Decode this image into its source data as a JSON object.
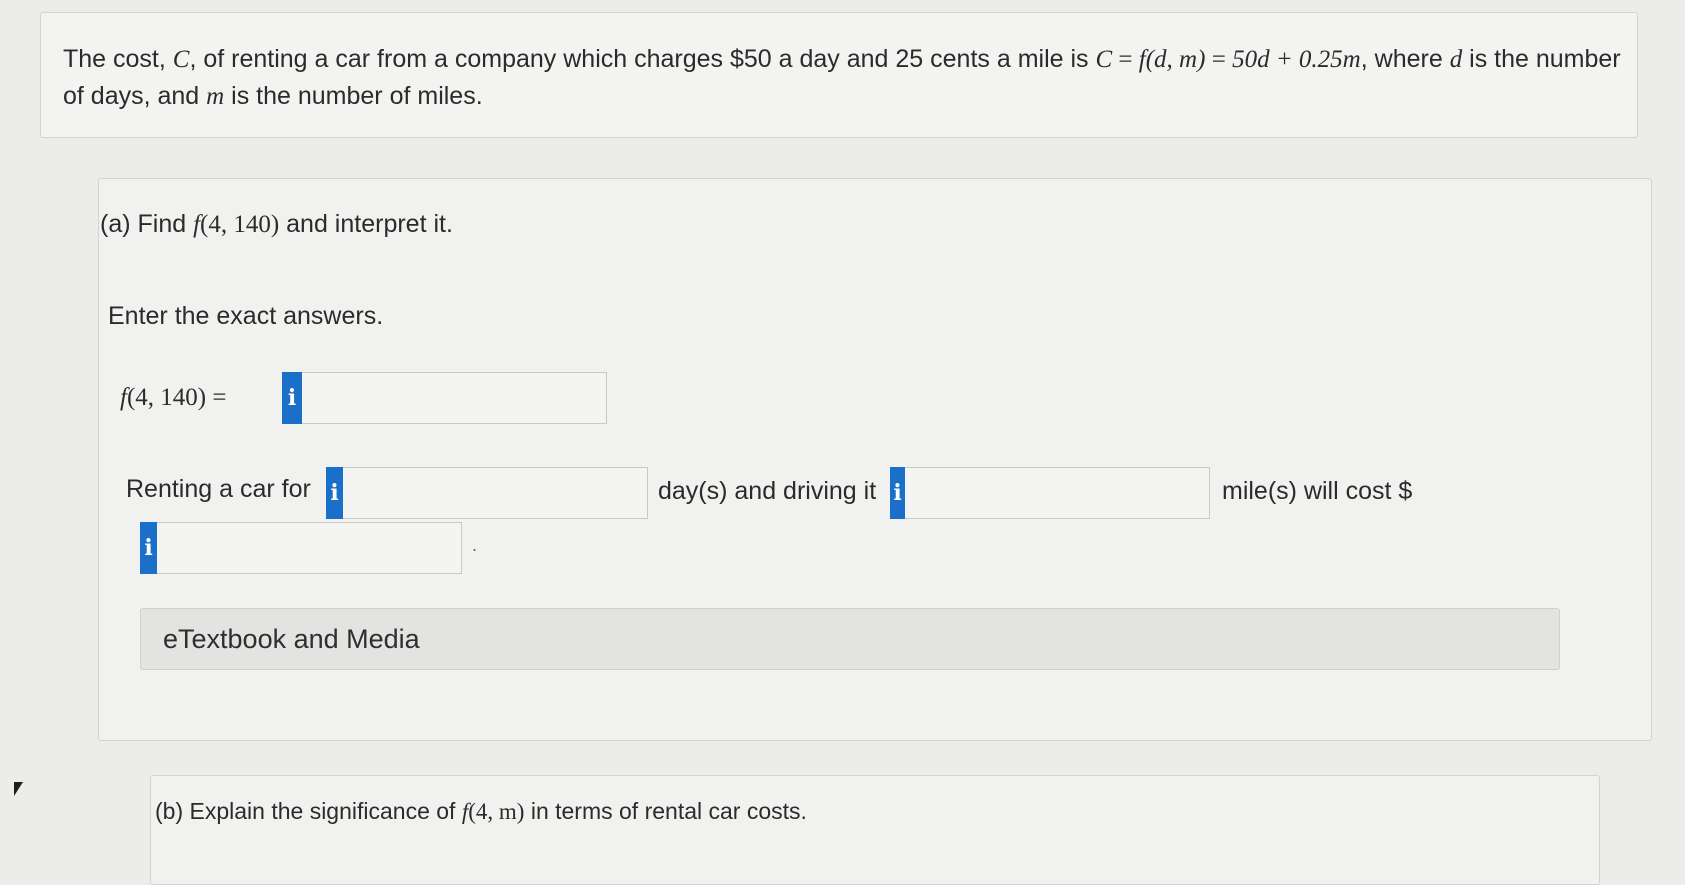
{
  "intro": {
    "t1": "The cost, ",
    "var_C": "C",
    "t2": ", of renting a car from a company which charges $50 a day and 25 cents a mile is ",
    "formula_lhs": "C",
    "formula_eq1": " = ",
    "formula_f": "f",
    "formula_args": "(d, m)",
    "formula_eq2": " = ",
    "formula_rhs": "50d + 0.25m",
    "t3": ", where ",
    "var_d": "d",
    "t4": " is the number of days, and ",
    "var_m": "m",
    "t5": " is the number of miles."
  },
  "part_a": {
    "prefix": "(a) Find ",
    "fn": "f",
    "args": "(4, 140)",
    "suffix": " and interpret it.",
    "instructions": "Enter the exact answers.",
    "eq_fn": "f",
    "eq_args": "(4, 140)",
    "eq_sign": " =",
    "info_glyph": "i",
    "f_value": "",
    "sentence_1": "Renting a car for",
    "days_value": "",
    "sentence_2": "day(s) and driving it",
    "miles_value": "",
    "sentence_3": "mile(s) will cost $",
    "cost_value": "",
    "period": ".",
    "media_label": "eTextbook and Media"
  },
  "part_b": {
    "prefix": "(b) Explain the significance of ",
    "fn": "f",
    "args": "(4, m)",
    "suffix": " in terms of rental car costs."
  },
  "icons": {
    "info": "info-icon",
    "cursor": "mouse-pointer-icon"
  },
  "colors": {
    "info_button": "#1a6fc9",
    "background": "#ecedeb"
  }
}
